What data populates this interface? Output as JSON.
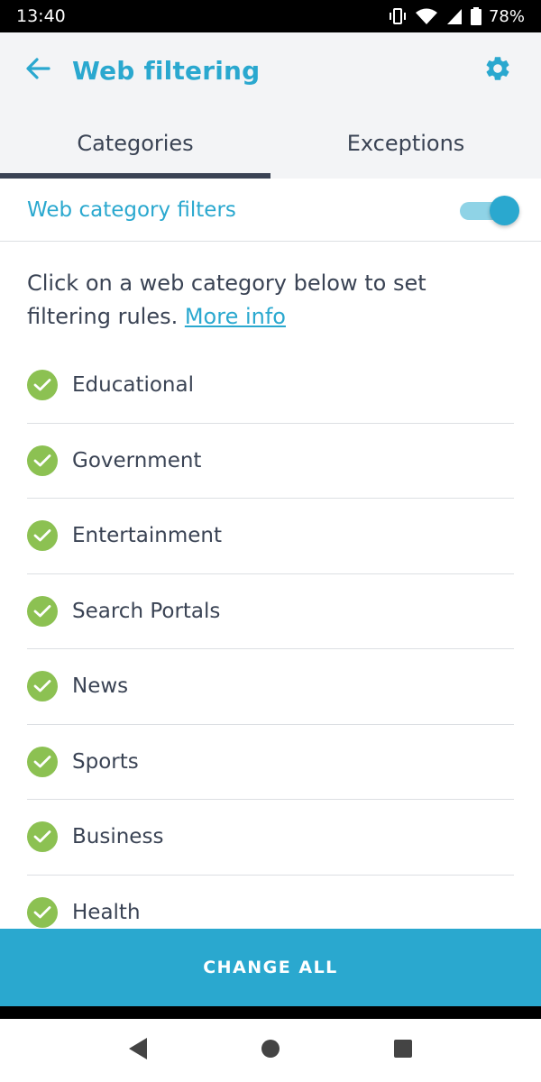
{
  "status_bar": {
    "time": "13:40",
    "battery": "78%",
    "icons": [
      "vibrate-icon",
      "wifi-icon",
      "signal-icon",
      "battery-icon"
    ]
  },
  "app_bar": {
    "title": "Web filtering",
    "back_icon": "arrow-left-icon",
    "settings_icon": "gear-icon"
  },
  "tabs": [
    {
      "label": "Categories",
      "active": true
    },
    {
      "label": "Exceptions",
      "active": false
    }
  ],
  "filter": {
    "label": "Web category filters",
    "enabled": true
  },
  "description": {
    "text": "Click on a web category below to set filtering rules. ",
    "link": "More info"
  },
  "categories": [
    {
      "label": "Educational",
      "status": "allowed"
    },
    {
      "label": "Government",
      "status": "allowed"
    },
    {
      "label": "Entertainment",
      "status": "allowed"
    },
    {
      "label": "Search Portals",
      "status": "allowed"
    },
    {
      "label": "News",
      "status": "allowed"
    },
    {
      "label": "Sports",
      "status": "allowed"
    },
    {
      "label": "Business",
      "status": "allowed"
    },
    {
      "label": "Health",
      "status": "allowed"
    }
  ],
  "action": {
    "label": "CHANGE ALL"
  },
  "colors": {
    "accent": "#2aa8cf",
    "check": "#8cc152",
    "text": "#3a4354"
  }
}
